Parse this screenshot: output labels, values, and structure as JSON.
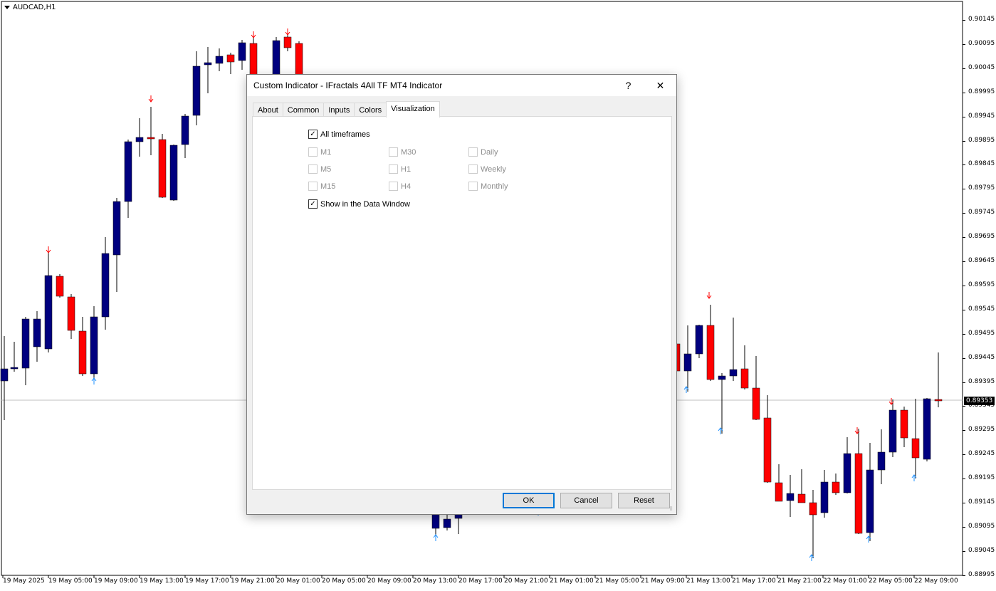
{
  "chart": {
    "symbol": "AUDCAD,H1",
    "current_price": "0.89353",
    "price_axis": [
      "0.90145",
      "0.90095",
      "0.90045",
      "0.89995",
      "0.89945",
      "0.89895",
      "0.89845",
      "0.89795",
      "0.89745",
      "0.89695",
      "0.89645",
      "0.89595",
      "0.89545",
      "0.89495",
      "0.89445",
      "0.89395",
      "0.89345",
      "0.89295",
      "0.89245",
      "0.89195",
      "0.89145",
      "0.89095",
      "0.89045",
      "0.88995"
    ],
    "time_axis": [
      "19 May 2025",
      "19 May 05:00",
      "19 May 09:00",
      "19 May 13:00",
      "19 May 17:00",
      "19 May 21:00",
      "20 May 01:00",
      "20 May 05:00",
      "20 May 09:00",
      "20 May 13:00",
      "20 May 17:00",
      "20 May 21:00",
      "21 May 01:00",
      "21 May 05:00",
      "21 May 09:00",
      "21 May 13:00",
      "21 May 17:00",
      "21 May 21:00",
      "22 May 01:00",
      "22 May 05:00",
      "22 May 09:00"
    ],
    "colors": {
      "bull": "#00007f",
      "bear": "#ff0000",
      "fractal_up": "#ff0000",
      "fractal_down": "#1e90ff",
      "grid": "#c0c0c0"
    }
  },
  "dialog": {
    "title": "Custom Indicator - IFractals 4All TF MT4 Indicator",
    "help_label": "?",
    "close_label": "✕",
    "tabs": [
      "About",
      "Common",
      "Inputs",
      "Colors",
      "Visualization"
    ],
    "active_tab": "Visualization",
    "all_timeframes": {
      "label": "All timeframes",
      "checked": true
    },
    "timeframes": {
      "col1": [
        "M1",
        "M5",
        "M15"
      ],
      "col2": [
        "M30",
        "H1",
        "H4"
      ],
      "col3": [
        "Daily",
        "Weekly",
        "Monthly"
      ]
    },
    "show_data_window": {
      "label": "Show in the Data Window",
      "checked": true
    },
    "buttons": {
      "ok": "OK",
      "cancel": "Cancel",
      "reset": "Reset"
    }
  }
}
